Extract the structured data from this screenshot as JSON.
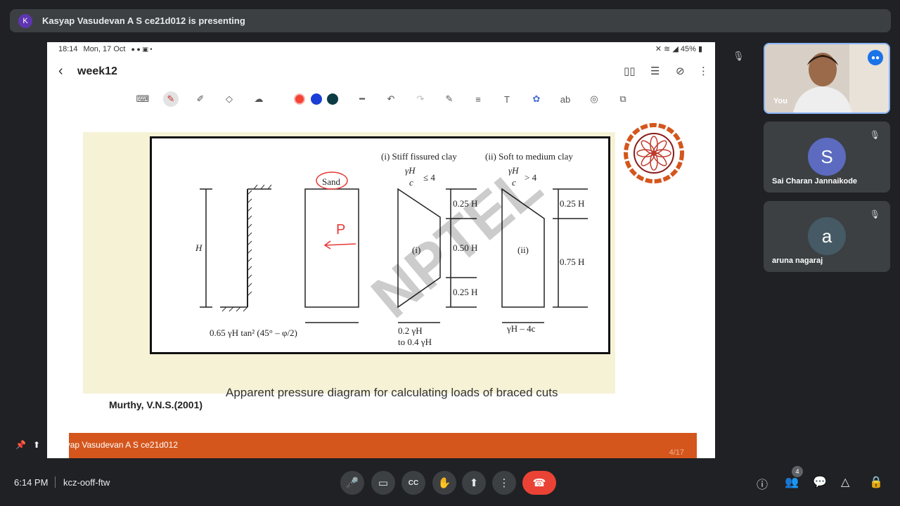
{
  "banner": {
    "avatar_letter": "K",
    "text": "Kasyap Vasudevan A S ce21d012 is presenting"
  },
  "tablet": {
    "status": {
      "time": "18:14",
      "date": "Mon, 17 Oct",
      "right": "45%"
    },
    "appbar": {
      "title": "week12"
    },
    "colors": {
      "red": "#f44336",
      "blue": "#1a3fd6",
      "dark": "#0d3b44"
    }
  },
  "slide": {
    "labels": {
      "sand": "Sand",
      "p": "P",
      "stiff": "(i) Stiff fissured clay",
      "soft": "(ii) Soft to medium clay",
      "gh_c": "γH",
      "c": "c",
      "le4": "≤ 4",
      "gt4": "> 4",
      "H": "H",
      "h025a": "0.25 H",
      "h050": "0.50 H",
      "h025b": "0.25 H",
      "h025c": "0.25 H",
      "h075": "0.75 H",
      "i": "(i)",
      "ii": "(ii)",
      "sand_formula": "0.65 γH tan² (45° – φ/2)",
      "clay1a": "0.2 γH",
      "clay1b": "to 0.4 γH",
      "clay2": "γH – 4c",
      "watermark": "NPTEL"
    },
    "caption": "Apparent pressure diagram for calculating loads of braced cuts",
    "credit": "Murthy, V.N.S.(2001)",
    "page": "4/17"
  },
  "presenter_label": "Kasyap Vasudevan A S ce21d012",
  "participants": [
    {
      "name": "You",
      "avatar": "",
      "color": ""
    },
    {
      "name": "Sai Charan Jannaikode",
      "avatar": "S",
      "color": "#5c6bc0"
    },
    {
      "name": "aruna nagaraj",
      "avatar": "a",
      "color": "#455a64"
    }
  ],
  "bottom": {
    "time": "6:14 PM",
    "code": "kcz-ooff-ftw",
    "people_count": "4"
  }
}
